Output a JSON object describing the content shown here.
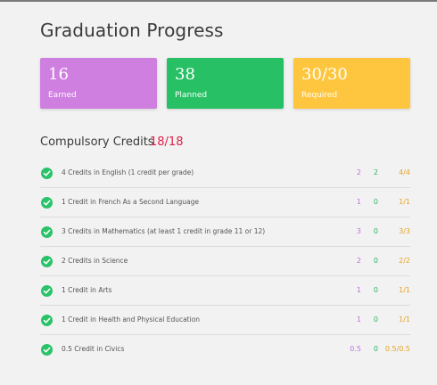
{
  "page": {
    "title": "Graduation Progress"
  },
  "summary_cards": [
    {
      "value": "16",
      "label": "Earned",
      "color": "#cf7fe0"
    },
    {
      "value": "38",
      "label": "Planned",
      "color": "#27c065"
    },
    {
      "value": "30/30",
      "label": "Required",
      "color": "#fec63e"
    }
  ],
  "section": {
    "title": "Compulsory Credits",
    "count": "18/18"
  },
  "requirements": [
    {
      "name": "4 Credits in English (1 credit per grade)",
      "earned": "2",
      "planned": "2",
      "required": "4/4"
    },
    {
      "name": "1 Credit in French As a Second Language",
      "earned": "1",
      "planned": "0",
      "required": "1/1"
    },
    {
      "name": "3 Credits in Mathematics (at least 1 credit in grade 11 or 12)",
      "earned": "3",
      "planned": "0",
      "required": "3/3"
    },
    {
      "name": "2 Credits in Science",
      "earned": "2",
      "planned": "0",
      "required": "2/2"
    },
    {
      "name": "1 Credit in Arts",
      "earned": "1",
      "planned": "0",
      "required": "1/1"
    },
    {
      "name": "1 Credit in Health and Physical Education",
      "earned": "1",
      "planned": "0",
      "required": "1/1"
    },
    {
      "name": "0.5 Credit in Civics",
      "earned": "0.5",
      "planned": "0",
      "required": "0.5/0.5"
    }
  ],
  "icons": {
    "row_status": "check-circle-icon"
  }
}
